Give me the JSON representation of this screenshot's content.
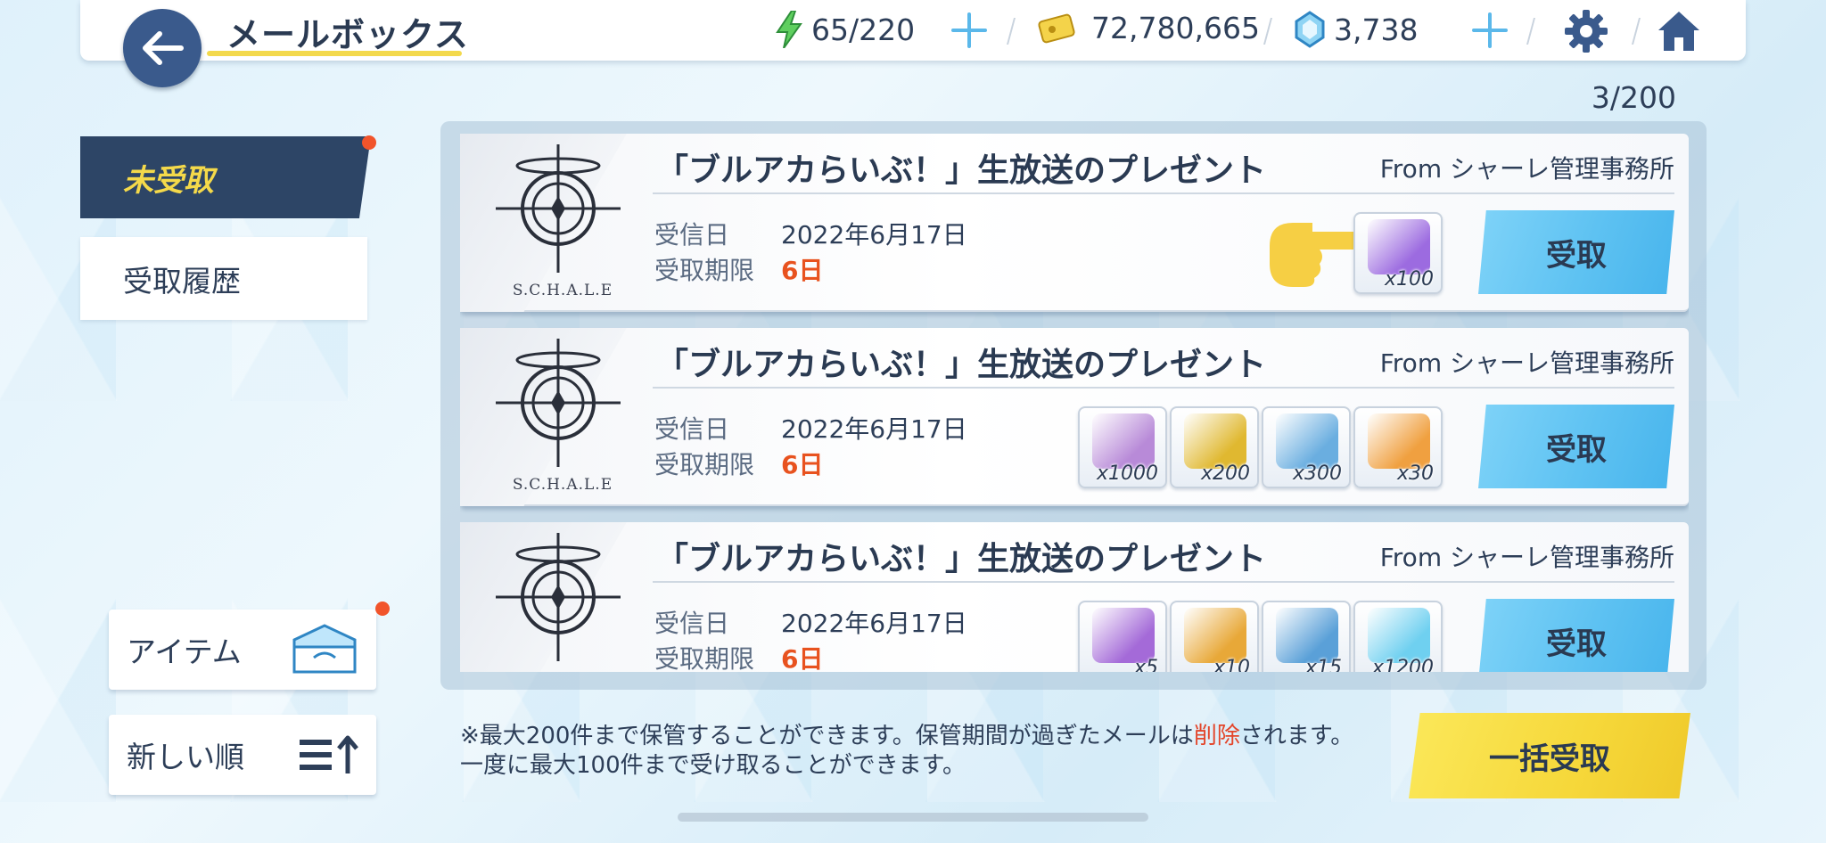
{
  "header": {
    "title": "メールボックス",
    "ap": "65/220",
    "credits": "72,780,665",
    "gems": "3,738"
  },
  "mail_count": "3/200",
  "tabs": {
    "unreceived": "未受取",
    "history": "受取履歴"
  },
  "side": {
    "item_filter": "アイテム",
    "sort": "新しい順"
  },
  "labels": {
    "received_date": "受信日",
    "deadline": "受取期限",
    "receive_button": "受取"
  },
  "mails": [
    {
      "title": "「ブルアカらいぶ！」生放送のプレゼント",
      "from": "From シャーレ管理事務所",
      "logo": "S.C.H.A.L.E",
      "date": "2022年6月17日",
      "deadline": "6日",
      "items": [
        {
          "icon": "purple-material-icon",
          "qty": "x100",
          "color": "#9c6be0"
        }
      ]
    },
    {
      "title": "「ブルアカらいぶ！」生放送のプレゼント",
      "from": "From シャーレ管理事務所",
      "logo": "S.C.H.A.L.E",
      "date": "2022年6月17日",
      "deadline": "6日",
      "items": [
        {
          "icon": "ticket-icon",
          "qty": "x1000",
          "color": "#b88ad8"
        },
        {
          "icon": "gold-material-icon",
          "qty": "x200",
          "color": "#e0b830"
        },
        {
          "icon": "blue-coin-icon",
          "qty": "x300",
          "color": "#6aaee0"
        },
        {
          "icon": "report-icon",
          "qty": "x30",
          "color": "#f0a040"
        }
      ]
    },
    {
      "title": "「ブルアカらいぶ！」生放送のプレゼント",
      "from": "From シャーレ管理事務所",
      "logo": "S.C.H.A.L.E",
      "date": "2022年6月17日",
      "deadline": "6日",
      "items": [
        {
          "icon": "purple-box-icon",
          "qty": "x5",
          "color": "#a46ad8"
        },
        {
          "icon": "gold-box-icon",
          "qty": "x10",
          "color": "#e8a838"
        },
        {
          "icon": "blue-box-icon",
          "qty": "x15",
          "color": "#5aa0d8"
        },
        {
          "icon": "crystal-icon",
          "qty": "x1200",
          "color": "#6fd0f0"
        }
      ]
    }
  ],
  "footer": {
    "note_1": "※最大200件まで保管することができます。保管期間が過ぎたメールは",
    "note_warn": "削除",
    "note_2": "されます。一度に最大100件まで受け取ることができます。",
    "bulk_button": "一括受取"
  },
  "colors": {
    "accent_yellow": "#f4d94a",
    "deadline_red": "#e8521f",
    "navy": "#2d4566",
    "receive_blue": "#5ec2f2"
  }
}
